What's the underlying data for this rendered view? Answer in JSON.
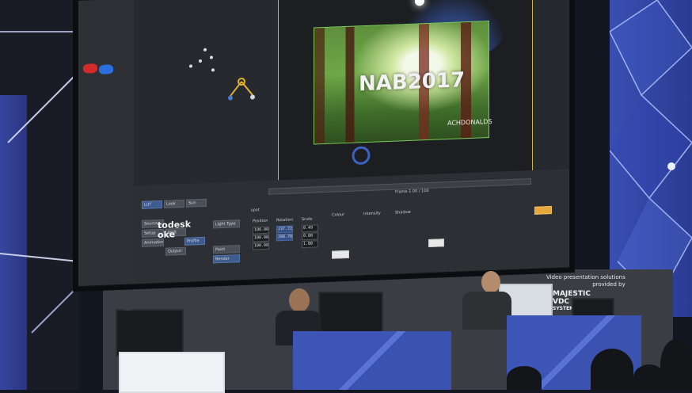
{
  "viewer": {
    "title_overlay": "NAB2017",
    "subtitle_overlay": "ACHDONALDS"
  },
  "brand": {
    "line1": "todesk",
    "line2": "oke"
  },
  "panel": {
    "buttons": [
      {
        "label": "LUT",
        "style": "blue"
      },
      {
        "label": "Look",
        "style": "plain"
      },
      {
        "label": "Sun",
        "style": "plain"
      },
      {
        "label": "Source",
        "style": "plain"
      },
      {
        "label": "Setup",
        "style": "plain"
      },
      {
        "label": "Animation",
        "style": "plain"
      },
      {
        "label": "Split",
        "style": "plain"
      },
      {
        "label": "Profile",
        "style": "plain"
      },
      {
        "label": "Light Type",
        "style": "plain"
      },
      {
        "label": "Paint",
        "style": "plain"
      },
      {
        "label": "Render",
        "style": "blue"
      },
      {
        "label": "Output",
        "style": "plain"
      }
    ],
    "fields": [
      "100.00",
      "100.00",
      "100.00",
      "237.72",
      "288.78",
      "0.49",
      "0.00",
      "1.00"
    ],
    "misc_labels": [
      "Position",
      "Rotation",
      "Scale",
      "Colour",
      "Intensity",
      "Shadow",
      "spot"
    ],
    "readout": "Frame 1.00 / 100"
  },
  "banner": {
    "line1": "Video presentation solutions",
    "line2": "provided by",
    "line3": "MAJESTIC",
    "line4": "VDC",
    "line5": "SYSTEMS"
  }
}
